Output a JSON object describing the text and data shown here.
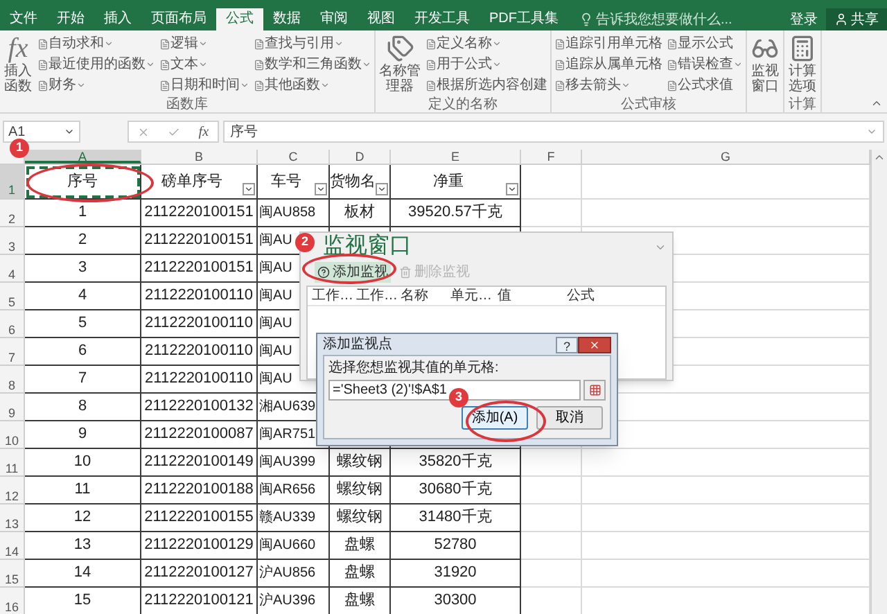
{
  "ribbon_tabs": [
    {
      "label": "文件",
      "selected": false
    },
    {
      "label": "开始",
      "selected": false
    },
    {
      "label": "插入",
      "selected": false
    },
    {
      "label": "页面布局",
      "selected": false
    },
    {
      "label": "公式",
      "selected": true
    },
    {
      "label": "数据",
      "selected": false
    },
    {
      "label": "审阅",
      "selected": false
    },
    {
      "label": "视图",
      "selected": false
    },
    {
      "label": "开发工具",
      "selected": false
    },
    {
      "label": "PDF工具集",
      "selected": false
    }
  ],
  "tell_me": {
    "placeholder": "告诉我您想要做什么..."
  },
  "account": {
    "sign_in": "登录",
    "share": "共享"
  },
  "ribbon_groups": [
    {
      "label": "函数库",
      "large": {
        "label": "插入函数",
        "icon": "fx"
      },
      "columns": [
        [
          {
            "label": "自动求和",
            "dropdown": true
          },
          {
            "label": "最近使用的函数",
            "dropdown": true
          },
          {
            "label": "财务",
            "dropdown": true
          }
        ],
        [
          {
            "label": "逻辑",
            "dropdown": true
          },
          {
            "label": "文本",
            "dropdown": true
          },
          {
            "label": "日期和时间",
            "dropdown": true
          }
        ],
        [
          {
            "label": "查找与引用",
            "dropdown": true
          },
          {
            "label": "数学和三角函数",
            "dropdown": true
          },
          {
            "label": "其他函数",
            "dropdown": true
          }
        ]
      ]
    },
    {
      "label": "定义的名称",
      "large": {
        "label": "名称管理器"
      },
      "columns": [
        [
          {
            "label": "定义名称",
            "dropdown": true
          },
          {
            "label": "用于公式",
            "dropdown": true
          },
          {
            "label": "根据所选内容创建",
            "dropdown": false
          }
        ]
      ]
    },
    {
      "label": "公式审核",
      "columns": [
        [
          {
            "label": "追踪引用单元格",
            "dropdown": false
          },
          {
            "label": "追踪从属单元格",
            "dropdown": false
          },
          {
            "label": "移去箭头",
            "dropdown": true
          }
        ],
        [
          {
            "label": "显示公式",
            "dropdown": false
          },
          {
            "label": "错误检查",
            "dropdown": true
          },
          {
            "label": "公式求值",
            "dropdown": false
          }
        ]
      ]
    },
    {
      "large": {
        "label": "监视窗口"
      }
    },
    {
      "label": "计算",
      "large": {
        "label": "计算选项"
      }
    }
  ],
  "formula_bar": {
    "name_box": "A1",
    "fx": "fx",
    "value": "序号"
  },
  "columns": [
    {
      "label": "A",
      "selected": true
    },
    {
      "label": "B",
      "selected": false
    },
    {
      "label": "C",
      "selected": false
    },
    {
      "label": "D",
      "selected": false
    },
    {
      "label": "E",
      "selected": false
    },
    {
      "label": "F",
      "selected": false
    },
    {
      "label": "G",
      "selected": false
    }
  ],
  "header_row": {
    "number": "1",
    "selected": true,
    "cells": [
      {
        "text": "序号",
        "filter": false,
        "selected": true
      },
      {
        "text": "磅单序号",
        "filter": true,
        "selected": false
      },
      {
        "text": "车号",
        "filter": true,
        "selected": false
      },
      {
        "text": "货物名",
        "filter": true,
        "selected": false
      },
      {
        "text": "净重",
        "filter": true,
        "selected": false
      }
    ]
  },
  "rows": [
    {
      "number": "2",
      "cells": [
        "1",
        "2112220100151",
        "闽AU858",
        "板材",
        "39520.57千克"
      ]
    },
    {
      "number": "3",
      "cells": [
        "2",
        "2112220100151",
        "闽AU"
      ]
    },
    {
      "number": "4",
      "cells": [
        "3",
        "2112220100151",
        "闽AU"
      ]
    },
    {
      "number": "5",
      "cells": [
        "4",
        "2112220100110",
        "闽AU"
      ]
    },
    {
      "number": "6",
      "cells": [
        "5",
        "2112220100110",
        "闽AU"
      ]
    },
    {
      "number": "7",
      "cells": [
        "6",
        "2112220100110",
        "闽AU"
      ]
    },
    {
      "number": "8",
      "cells": [
        "7",
        "2112220100110",
        "闽AU"
      ]
    },
    {
      "number": "9",
      "cells": [
        "8",
        "2112220100132",
        "湘AU639"
      ]
    },
    {
      "number": "10",
      "cells": [
        "9",
        "2112220100087",
        "闽AR751"
      ]
    },
    {
      "number": "11",
      "cells": [
        "10",
        "2112220100149",
        "闽AU399",
        "螺纹钢",
        "35820千克"
      ]
    },
    {
      "number": "12",
      "cells": [
        "11",
        "2112220100188",
        "闽AR656",
        "螺纹钢",
        "30680千克"
      ]
    },
    {
      "number": "13",
      "cells": [
        "12",
        "2112220100155",
        "赣AU339",
        "螺纹钢",
        "31480千克"
      ]
    },
    {
      "number": "14",
      "cells": [
        "13",
        "2112220100129",
        "闽AU660",
        "盘螺",
        "52780"
      ]
    },
    {
      "number": "15",
      "cells": [
        "14",
        "2112220100127",
        "沪AU856",
        "盘螺",
        "31920"
      ]
    },
    {
      "number": "16",
      "cells": [
        "15",
        "2112220100121",
        "沪AU396",
        "盘螺",
        "30300"
      ]
    }
  ],
  "watch_window": {
    "title": "监视窗口",
    "toolbar": [
      {
        "label": "添加监视",
        "disabled": false
      },
      {
        "label": "删除监视",
        "disabled": true
      }
    ],
    "columns": [
      "工作…",
      "工作…",
      "名称",
      "单元…",
      "值",
      "公式"
    ]
  },
  "dialog": {
    "title": "添加监视点",
    "help": "?",
    "prompt": "选择您想监视其值的单元格:",
    "value": "='Sheet3 (2)'!$A$1",
    "buttons": [
      {
        "label": "添加(A)",
        "kind": "primary"
      },
      {
        "label": "取消",
        "kind": "normal"
      }
    ]
  },
  "annotations": [
    {
      "label": "1"
    },
    {
      "label": "2"
    },
    {
      "label": "3"
    }
  ]
}
